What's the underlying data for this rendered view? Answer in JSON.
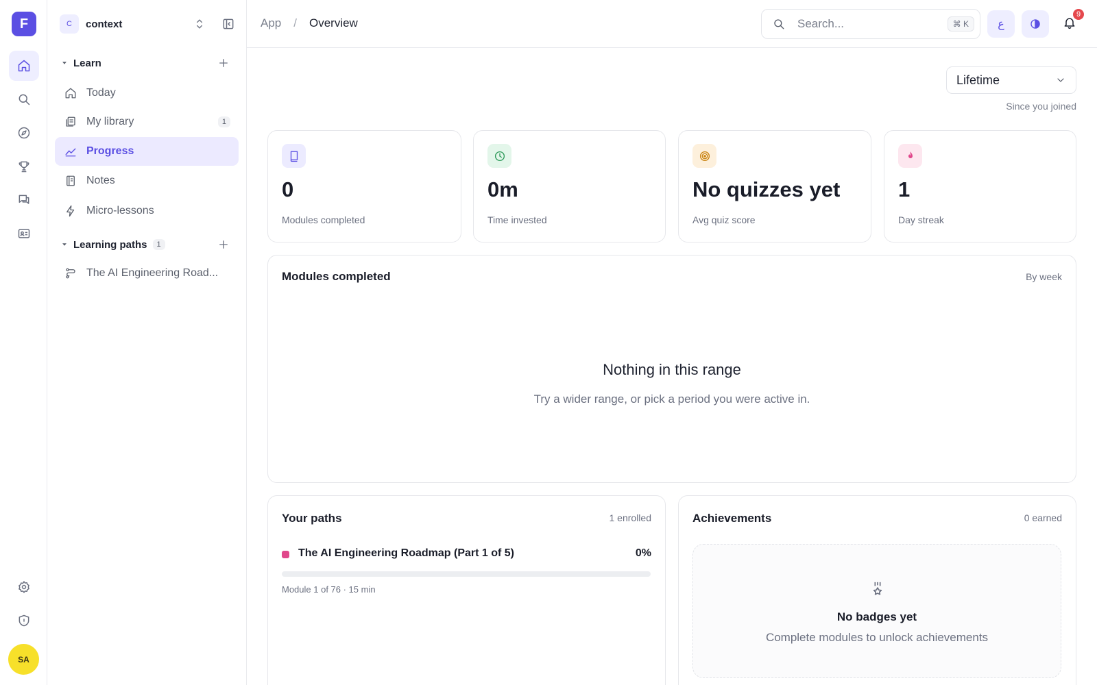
{
  "app": {
    "logo_letter": "F",
    "avatar_initials": "SA"
  },
  "rail": {
    "icons": [
      "home-icon",
      "search-icon",
      "compass-icon",
      "trophy-icon",
      "chat-icon",
      "id-card-icon",
      "settings-icon",
      "shield-icon"
    ]
  },
  "workspace": {
    "badge": "C",
    "name": "context"
  },
  "sidebar": {
    "learn": {
      "title": "Learn",
      "items": [
        {
          "label": "Today",
          "icon": "home-icon"
        },
        {
          "label": "My library",
          "icon": "library-icon",
          "count": "1"
        },
        {
          "label": "Progress",
          "icon": "chart-icon",
          "active": true
        },
        {
          "label": "Notes",
          "icon": "notebook-icon"
        },
        {
          "label": "Micro-lessons",
          "icon": "lightning-icon"
        }
      ]
    },
    "paths": {
      "title": "Learning paths",
      "count": "1",
      "items": [
        {
          "label": "The AI Engineering Road...",
          "icon": "route-icon"
        }
      ]
    }
  },
  "topbar": {
    "breadcrumb": {
      "root": "App",
      "sep": "/",
      "current": "Overview"
    },
    "search": {
      "placeholder": "Search...",
      "shortcut": "⌘ K"
    },
    "lang_button": "ع",
    "notifications": {
      "count": "9"
    }
  },
  "main": {
    "range": {
      "selected": "Lifetime",
      "sub": "Since you joined"
    },
    "stats": [
      {
        "value": "0",
        "label": "Modules completed",
        "icon": "book-icon",
        "icon_bg": "#ecebff",
        "icon_color": "#5b4fe3"
      },
      {
        "value": "0m",
        "label": "Time invested",
        "icon": "clock-icon",
        "icon_bg": "#e3f6ea",
        "icon_color": "#2e9a5a"
      },
      {
        "value": "No quizzes yet",
        "label": "Avg quiz score",
        "icon": "target-icon",
        "icon_bg": "#fdf0dc",
        "icon_color": "#c9820e"
      },
      {
        "value": "1",
        "label": "Day streak",
        "icon": "flame-icon",
        "icon_bg": "#fde7ef",
        "icon_color": "#e0478b"
      }
    ],
    "modules_chart": {
      "title": "Modules completed",
      "meta": "By week",
      "empty_title": "Nothing in this range",
      "empty_sub": "Try a wider range, or pick a period you were active in."
    },
    "paths": {
      "title": "Your paths",
      "meta": "1 enrolled",
      "items": [
        {
          "name": "The AI Engineering Roadmap (Part 1 of 5)",
          "percent": "0%",
          "progress": 0,
          "sub": "Module 1 of 76 · 15 min",
          "color": "#e0478b"
        }
      ]
    },
    "achievements": {
      "title": "Achievements",
      "meta": "0 earned",
      "empty_title": "No badges yet",
      "empty_sub": "Complete modules to unlock achievements"
    }
  }
}
